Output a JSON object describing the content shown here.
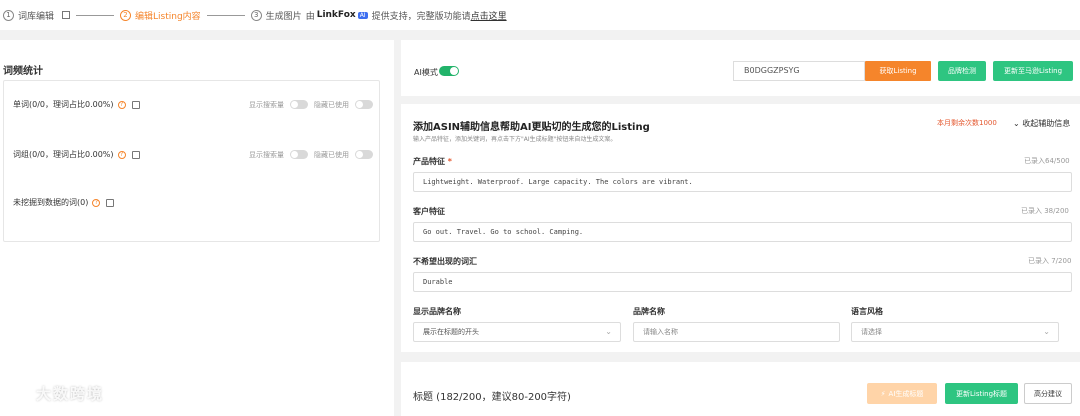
{
  "steps": [
    {
      "num": "1",
      "label": "词库编辑"
    },
    {
      "num": "2",
      "label": "编辑Listing内容"
    },
    {
      "num": "3",
      "label": "生成图片"
    }
  ],
  "support": {
    "prefix": "由",
    "brand": "LinkFox",
    "badge": "AI",
    "suffix": "提供支持，完整版功能请",
    "link": "点击这里"
  },
  "stats": {
    "title": "词频统计",
    "rows": [
      {
        "label": "单词(0/0，理词占比0.00%)",
        "opt1": "显示搜索量",
        "opt2": "隐藏已使用"
      },
      {
        "label": "词组(0/0，理词占比0.00%)",
        "opt1": "显示搜索量",
        "opt2": "隐藏已使用"
      },
      {
        "label": "未挖掘到数据的词(0)"
      }
    ]
  },
  "toolbar": {
    "ai_mode": "AI模式",
    "asin_value": "B0DGGZPSYG",
    "get_listing": "获取Listing",
    "brand_check": "品牌检测",
    "update_amazon": "更新至马逊Listing"
  },
  "form": {
    "title": "添加ASIN辅助信息帮助AI更贴切的生成您的Listing",
    "subtitle": "输入产品特征，添加关键词，再点击下方\"AI生成标题\"按钮来自动生成文案。",
    "remain": "本月剩余次数1000",
    "collapse": "收起辅助信息",
    "features_label": "产品特征",
    "features_required": "*",
    "features_count": "已录入64/500",
    "features_value": "Lightweight. Waterproof. Large capacity. The colors are vibrant.",
    "customer_label": "客户特征",
    "customer_count": "已录入 38/200",
    "customer_value": "Go out. Travel. Go to school. Camping.",
    "avoid_label": "不希望出现的词汇",
    "avoid_count": "已录入 7/200",
    "avoid_value": "Durable",
    "brand_display_label": "显示品牌名称",
    "brand_display_value": "展示在标题的开头",
    "brand_name_label": "品牌名称",
    "brand_name_placeholder": "请输入名称",
    "style_label": "语言风格",
    "style_placeholder": "请选择"
  },
  "bottom": {
    "title": "标题 (182/200，建议80-200字符)",
    "ai_button": "AI生成标题",
    "update_button": "更新Listing标题",
    "score_button": "高分建议"
  },
  "watermark": "大数跨境"
}
